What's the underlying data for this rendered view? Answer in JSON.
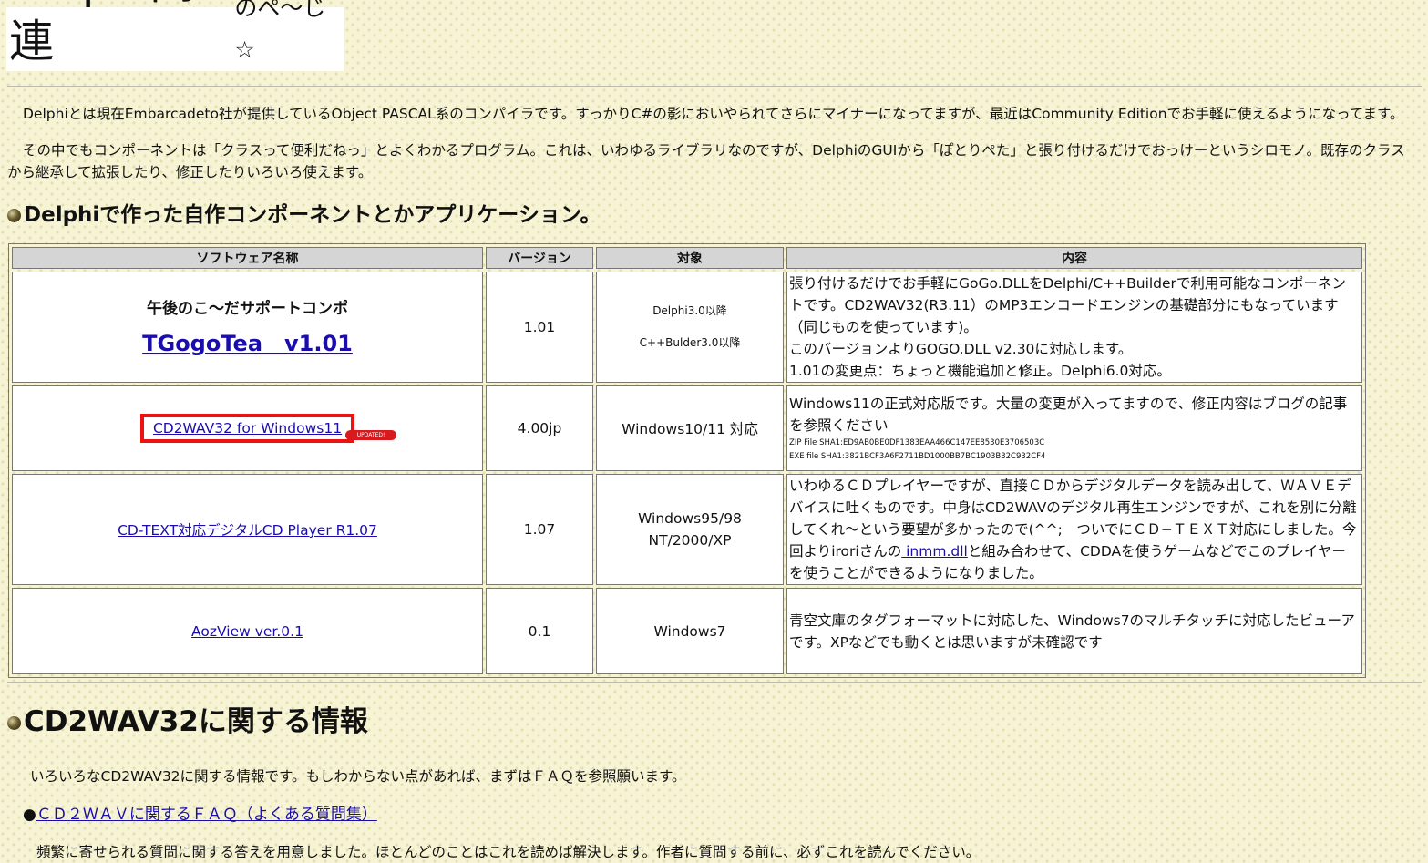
{
  "header": {
    "title_main": "Delphi関連",
    "title_sub": "のぺ〜じ☆"
  },
  "intro": {
    "p1": "Delphiとは現在Embarcadeto社が提供しているObject PASCAL系のコンパイラです。すっかりC#の影においやられてさらにマイナーになってますが、最近はCommunity Editionでお手軽に使えるようになってます。",
    "p2": "その中でもコンポーネントは「クラスって便利だねっ」とよくわかるプログラム。これは、いわゆるライブラリなのですが、DelphiのGUIから「ぽとりぺた」と張り付けるだけでおっけーというシロモノ。既存のクラスから継承して拡張したり、修正したりいろいろ使えます。"
  },
  "section1": {
    "heading": "Delphiで作った自作コンポーネントとかアプリケーション。"
  },
  "table": {
    "headers": [
      "ソフトウェア名称",
      "バージョン",
      "対象",
      "内容"
    ],
    "rows": [
      {
        "name_sub": "午後のこ〜だサポートコンポ",
        "name": "TGogoTea　v1.01",
        "version": "1.01",
        "target1": "Delphi3.0以降",
        "target2": "C++Bulder3.0以降",
        "desc": "張り付けるだけでお手軽にGoGo.DLLをDelphi/C++Builderで利用可能なコンポーネントです。CD2WAV32(R3.11）のMP3エンコードエンジンの基礎部分にもなっています（同じものを使っています)。",
        "desc2": "このバージョンよりGOGO.DLL v2.30に対応します。",
        "desc3": "1.01の変更点：ちょっと機能追加と修正。Delphi6.0対応。"
      },
      {
        "name": "CD2WAV32 for Windows11",
        "badge": "UPDATED!",
        "version": "4.00jp",
        "target": "Windows10/11 対応",
        "desc": "Windows11の正式対応版です。大量の変更が入ってますので、修正内容はブログの記事を参照ください",
        "hash_zip": "ZIP File SHA1:ED9AB0BE0DF1383EAA466C147EE8530E3706503C",
        "hash_exe": "EXE file SHA1:3821BCF3A6F2711BD1000BB7BC1903B32C932CF4"
      },
      {
        "name": "CD-TEXT対応デジタルCD Player R1.07",
        "version": "1.07",
        "target1": "Windows95/98",
        "target2": "NT/2000/XP",
        "desc_before": "いわゆるＣＤプレイヤーですが、直接ＣＤからデジタルデータを読み出して、ＷＡＶＥデバイスに吐くものです。中身はCD2WAVのデジタル再生エンジンですが、これを別に分離してくれ〜という要望が多かったので(^^;　ついでにＣＤ−ＴＥＸＴ対応にしました。今回よりiroriさんの",
        "desc_link": " inmm.dll",
        "desc_after": "と組み合わせて、CDDAを使うゲームなどでこのプレイヤーを使うことができるようになりました。"
      },
      {
        "name": "AozView ver.0.1",
        "version": "0.1",
        "target": "Windows7",
        "desc": "青空文庫のタグフォーマットに対応した、Windows7のマルチタッチに対応したビューアです。XPなどでも動くとは思いますが未確認です"
      }
    ]
  },
  "section2": {
    "heading": "CD2WAV32に関する情報",
    "intro": "いろいろなCD2WAV32に関する情報です。もしわからない点があれば、まずはＦＡＱを参照願います。",
    "faq_bullet": "●",
    "faq_link": "ＣＤ２ＷＡＶに関するＦＡＱ（よくある質問集）",
    "faq_desc": "頻繁に寄せられる質問に関する答えを用意しました。ほとんどのことはこれを読めば解決します。作者に質問する前に、必ずこれを読んでください。"
  }
}
